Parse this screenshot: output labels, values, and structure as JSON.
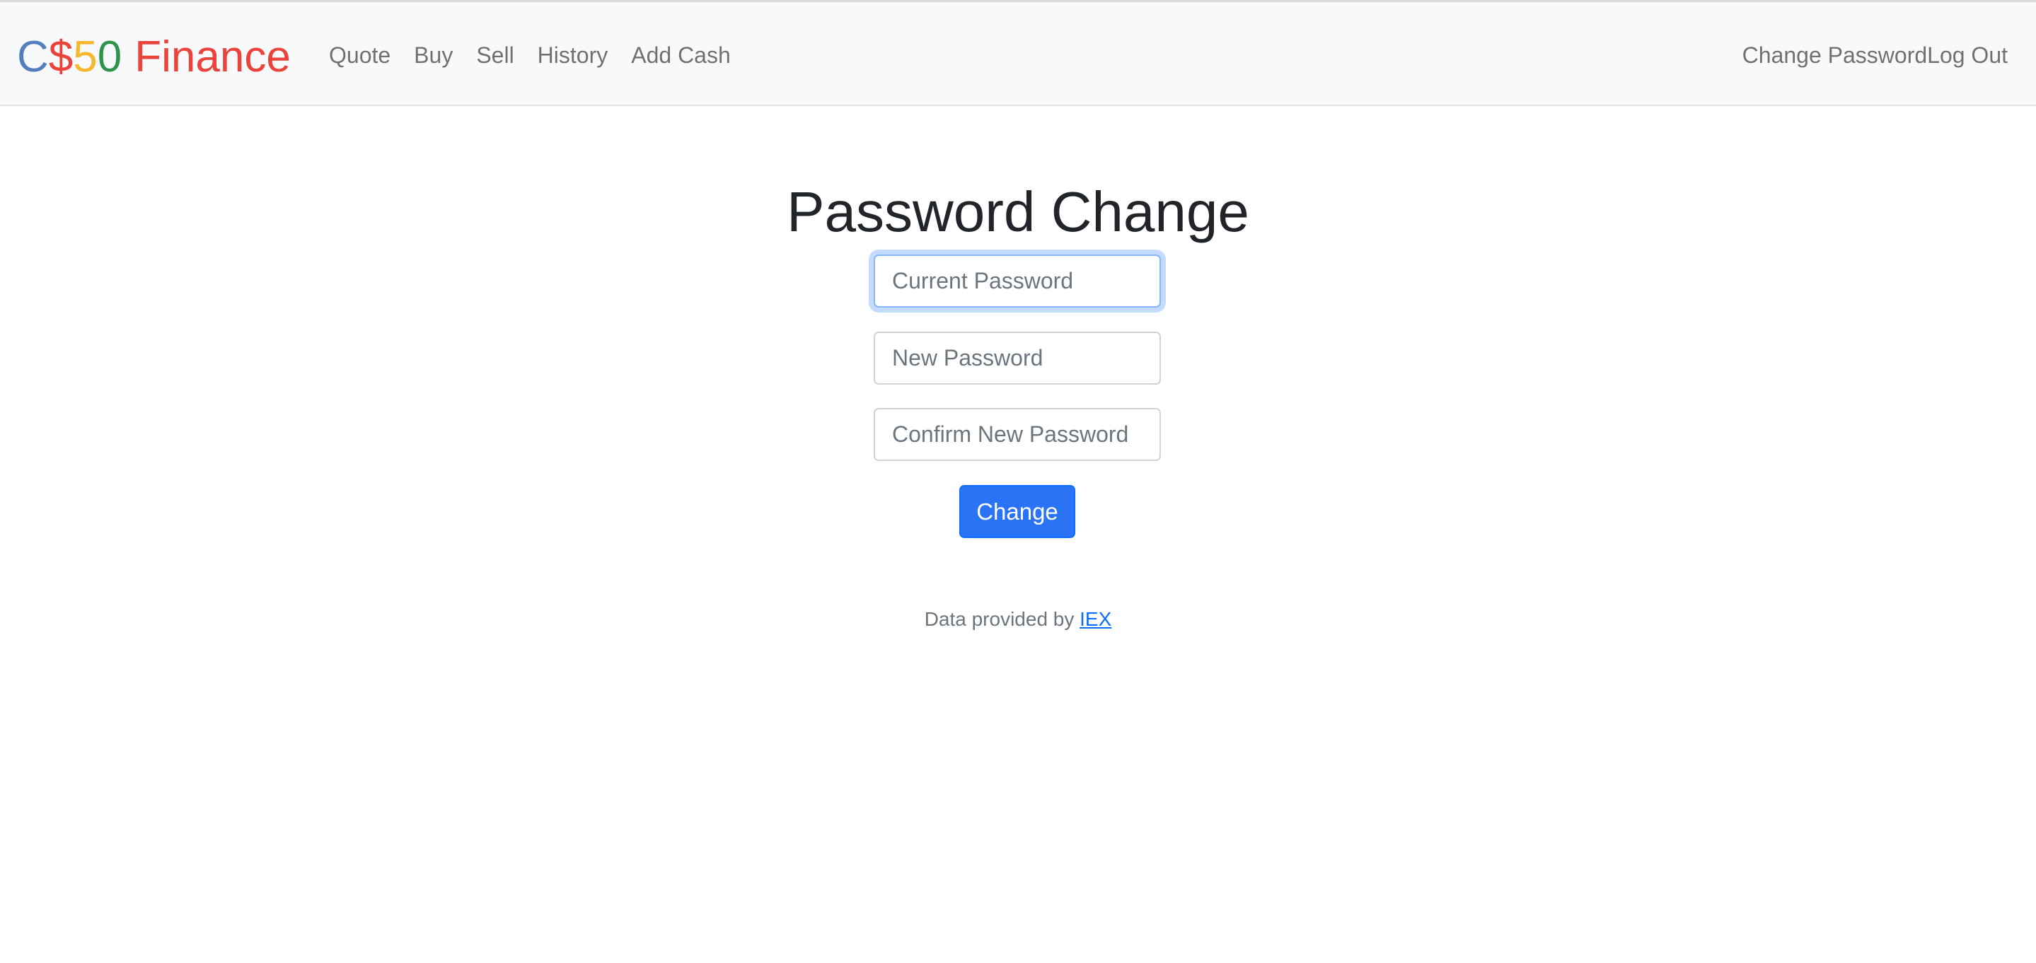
{
  "brand": {
    "c": "C",
    "dollar": "$",
    "five": "5",
    "zero": "0",
    "finance": "Finance",
    "colors": {
      "blue": "#537fbe",
      "red": "#ea433b",
      "yellow": "#f5b82e",
      "green": "#2e944b"
    }
  },
  "nav": {
    "left": [
      {
        "label": "Quote"
      },
      {
        "label": "Buy"
      },
      {
        "label": "Sell"
      },
      {
        "label": "History"
      },
      {
        "label": "Add Cash"
      }
    ],
    "right": [
      {
        "label": "Change Password"
      },
      {
        "label": "Log Out"
      }
    ]
  },
  "main": {
    "title": "Password Change",
    "current_password": {
      "placeholder": "Current Password",
      "value": ""
    },
    "new_password": {
      "placeholder": "New Password",
      "value": ""
    },
    "confirm_password": {
      "placeholder": "Confirm New Password",
      "value": ""
    },
    "submit_label": "Change",
    "accent_color": "#0d6efd"
  },
  "footer": {
    "text": "Data provided by",
    "link_label": "IEX"
  }
}
